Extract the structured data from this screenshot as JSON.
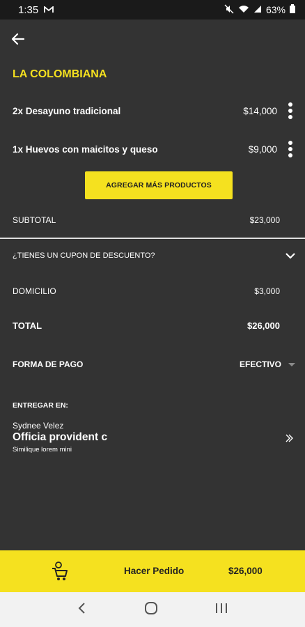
{
  "status": {
    "time": "1:35",
    "battery": "63%"
  },
  "restaurant": "LA COLOMBIANA",
  "items": [
    {
      "name": "2x Desayuno tradicional",
      "price": "$14,000"
    },
    {
      "name": "1x Huevos con maicitos y queso",
      "price": "$9,000"
    }
  ],
  "add_button": "AGREGAR MÁS PRODUCTOS",
  "subtotal": {
    "label": "SUBTOTAL",
    "value": "$23,000"
  },
  "coupon": {
    "label": "¿TIENES UN CUPON DE DESCUENTO?"
  },
  "delivery": {
    "label": "DOMICILIO",
    "value": "$3,000"
  },
  "total": {
    "label": "TOTAL",
    "value": "$26,000"
  },
  "payment": {
    "label": "FORMA DE PAGO",
    "value": "EFECTIVO"
  },
  "deliver_to": {
    "title": "ENTREGAR EN:",
    "name": "Sydnee Velez",
    "address": "Officia provident c",
    "detail": "Similique lorem mini"
  },
  "order": {
    "label": "Hacer Pedido",
    "total": "$26,000"
  },
  "colors": {
    "accent": "#f5e11f",
    "background": "#333333"
  }
}
